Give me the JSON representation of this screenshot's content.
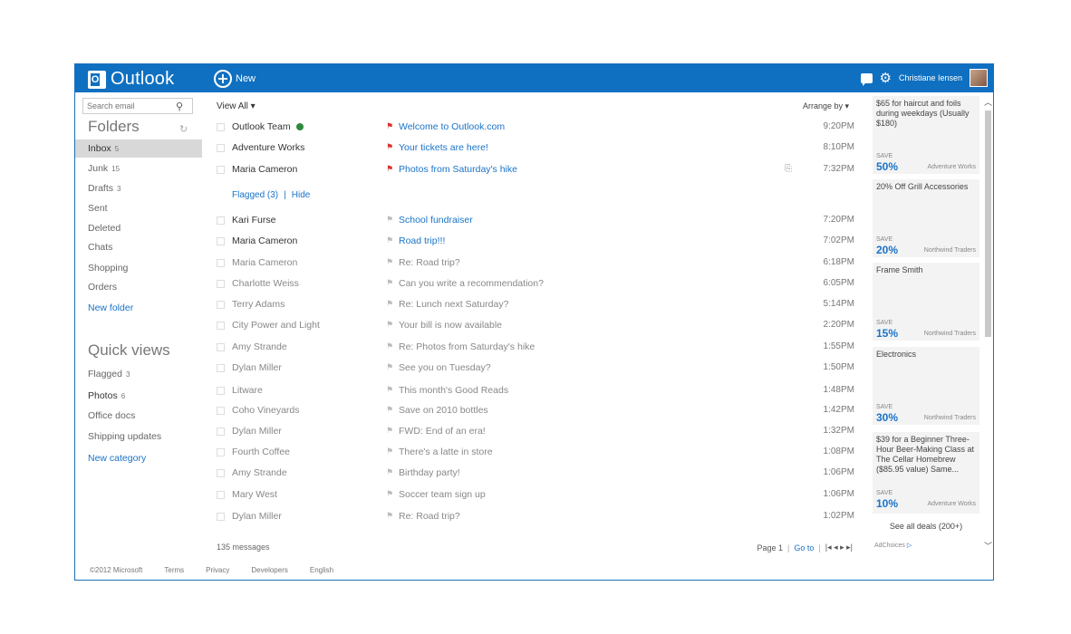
{
  "topbar": {
    "brand": "Outlook",
    "brand_letter": "O",
    "new_label": "New",
    "user_name": "Christiane Iensen"
  },
  "leftnav": {
    "search_placeholder": "Search email",
    "folders_title": "Folders",
    "folders": [
      {
        "label": "Inbox",
        "count": "5"
      },
      {
        "label": "Junk",
        "count": "15"
      },
      {
        "label": "Drafts",
        "count": "3"
      },
      {
        "label": "Sent",
        "count": ""
      },
      {
        "label": "Deleted",
        "count": ""
      },
      {
        "label": "Chats",
        "count": ""
      },
      {
        "label": "Shopping",
        "count": ""
      },
      {
        "label": "Orders",
        "count": ""
      }
    ],
    "new_folder": "New folder",
    "quick_views_title": "Quick views",
    "quick_views": [
      {
        "label": "Flagged",
        "count": "3"
      },
      {
        "label": "Photos",
        "count": "6"
      },
      {
        "label": "Office docs",
        "count": ""
      },
      {
        "label": "Shipping updates",
        "count": ""
      }
    ],
    "new_category": "New category"
  },
  "list": {
    "view_all": "View All",
    "arrange_by": "Arrange by",
    "flagged_link": "Flagged (3)",
    "separator": "|",
    "hide_link": "Hide",
    "flagged_messages": [
      {
        "sender": "Outlook Team",
        "subject": "Welcome to Outlook.com",
        "time": "9:20PM"
      },
      {
        "sender": "Adventure Works",
        "subject": "Your tickets are here!",
        "time": "8:10PM"
      },
      {
        "sender": "Maria Cameron",
        "subject": "Photos from Saturday's hike",
        "time": "7:32PM"
      }
    ],
    "messages": [
      {
        "sender": "Kari Furse",
        "subject": "School fundraiser",
        "time": "7:20PM"
      },
      {
        "sender": "Maria Cameron",
        "subject": "Road trip!!!",
        "time": "7:02PM"
      },
      {
        "sender": "Maria Cameron",
        "subject": "Re: Road trip?",
        "time": "6:18PM"
      },
      {
        "sender": "Charlotte Weiss",
        "subject": "Can you write a recommendation?",
        "time": "6:05PM"
      },
      {
        "sender": "Terry Adams",
        "subject": "Re: Lunch next Saturday?",
        "time": "5:14PM"
      },
      {
        "sender": "City Power and Light",
        "subject": "Your bill is now available",
        "time": "2:20PM"
      },
      {
        "sender": "Amy Strande",
        "subject": "Re: Photos from Saturday's hike",
        "time": "1:55PM"
      },
      {
        "sender": "Dylan Miller",
        "subject": "See you on Tuesday?",
        "time": "1:50PM"
      },
      {
        "sender": "Litware",
        "subject": "This month's Good Reads",
        "time": "1:48PM"
      },
      {
        "sender": "Coho Vineyards",
        "subject": "Save on 2010 bottles",
        "time": "1:42PM"
      },
      {
        "sender": "Dylan Miller",
        "subject": "FWD: End of an era!",
        "time": "1:32PM"
      },
      {
        "sender": "Fourth Coffee",
        "subject": "There's a latte in store",
        "time": "1:08PM"
      },
      {
        "sender": "Amy Strande",
        "subject": "Birthday party!",
        "time": "1:06PM"
      },
      {
        "sender": "Mary West",
        "subject": "Soccer team sign up",
        "time": "1:06PM"
      },
      {
        "sender": "Dylan Miller",
        "subject": "Re: Road trip?",
        "time": "1:02PM"
      }
    ],
    "message_count": "135 messages",
    "page_label": "Page 1",
    "goto_label": "Go to",
    "pager_arrows": "|◂ ◂ ▸ ▸|"
  },
  "ads": {
    "items": [
      {
        "title": "$65 for haircut and foils during weekdays (Usually $180)",
        "save_label": "SAVE",
        "save": "50%",
        "merchant": "Adventure Works"
      },
      {
        "title": "20% Off Grill Accessories",
        "save_label": "SAVE",
        "save": "20%",
        "merchant": "Northwind Traders"
      },
      {
        "title": "Frame Smith",
        "save_label": "SAVE",
        "save": "15%",
        "merchant": "Northwind Traders"
      },
      {
        "title": "Electronics",
        "save_label": "SAVE",
        "save": "30%",
        "merchant": "Northwind Traders"
      },
      {
        "title": "$39 for a Beginner Three-Hour Beer-Making Class at The Cellar Homebrew ($85.95 value) Same...",
        "save_label": "SAVE",
        "save": "10%",
        "merchant": "Adventure Works"
      }
    ],
    "see_all": "See all deals (200+)",
    "adchoices": "AdChoices"
  },
  "footer": {
    "copyright": "©2012 Microsoft",
    "terms": "Terms",
    "privacy": "Privacy",
    "developers": "Developers",
    "language": "English"
  },
  "colors": {
    "brand_blue": "#0f70c1",
    "link_blue": "#1a73c8",
    "flag_red": "#d9302c",
    "presence_green": "#2e8b3d"
  }
}
